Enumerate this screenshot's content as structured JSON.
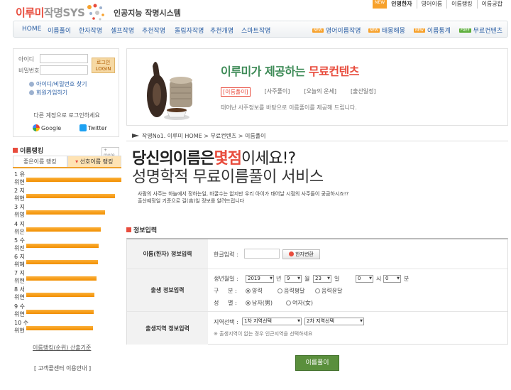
{
  "header": {
    "logo_red": "이루미",
    "logo_gray": "작명SYS",
    "subtitle": "인공지능 작명시스템",
    "top_links": [
      {
        "label": "인명한자",
        "badge": "NEW"
      },
      {
        "label": "영어이름"
      },
      {
        "label": "이름랭킹"
      },
      {
        "label": "이름궁합"
      }
    ]
  },
  "nav": [
    {
      "label": "HOME"
    },
    {
      "label": "이름풀이"
    },
    {
      "label": "한자작명"
    },
    {
      "label": "셀프작명"
    },
    {
      "label": "추천작명"
    },
    {
      "label": "돌림자작명"
    },
    {
      "label": "추천개명"
    },
    {
      "label": "스마트작명"
    },
    {
      "label": "영어이름작명",
      "badge": "NEW"
    },
    {
      "label": "태몽해몽",
      "badge": "NEW"
    },
    {
      "label": "이름통계",
      "badge": "NEW"
    },
    {
      "label": "무료컨텐츠",
      "badge": "FREE"
    }
  ],
  "login": {
    "id_label": "아이디",
    "pw_label": "비밀번호",
    "login_button_1": "로그인",
    "login_button_2": "LOGIN",
    "find_link": "아이디/비밀번호 찾기",
    "join_link": "회원가입하기",
    "social_note": "다른 계정으로 로그인하세요",
    "google": "Google",
    "twitter": "Twitter"
  },
  "ranking": {
    "title": "이름랭킹",
    "more": "more",
    "tabs": [
      "좋은이름 랭킹",
      "선호이름 랭킹"
    ],
    "rows": [
      {
        "line1": "1 유",
        "line2": "위현",
        "fill": 1.0
      },
      {
        "line1": "2 지",
        "line2": "위현",
        "fill": 0.93
      },
      {
        "line1": "3 지",
        "line2": "위영",
        "fill": 0.83
      },
      {
        "line1": "4 지",
        "line2": "위은",
        "fill": 0.78
      },
      {
        "line1": "5 수",
        "line2": "위진",
        "fill": 0.76
      },
      {
        "line1": "6 지",
        "line2": "위혜",
        "fill": 0.75
      },
      {
        "line1": "7 지",
        "line2": "위현",
        "fill": 0.74
      },
      {
        "line1": "8 서",
        "line2": "위연",
        "fill": 0.72
      },
      {
        "line1": "9 수",
        "line2": "위연",
        "fill": 0.71
      },
      {
        "line1": "10 수",
        "line2": "위현",
        "fill": 0.7
      }
    ],
    "footer_link": "이름랭킹(순위) 산출기준",
    "help_link": "[ 고객콜센터 이용안내 ]"
  },
  "promo": {
    "title_green": "이루미가 제공하는 ",
    "title_red": "무료컨텐츠",
    "tabs": [
      "[이름풀이]",
      "[사주풀이]",
      "[오늘의 운세]",
      "[출산일정]"
    ],
    "desc": "태어난 사주정보를 바탕으로 이름풀이를 제공해 드립니다."
  },
  "breadcrumb": "작명No1. 이루미 HOME > 무료컨텐츠 > 이름풀이",
  "headline": {
    "part1": "당신의이름은",
    "part2": "몇점",
    "part3": "이세요!?",
    "line2": "성명학적 무료이름풀이 서비스",
    "intro1": "사람의 사주는 하늘에서 정하는일, 바꿀수는 없지만 우리 아이가 태어날 시점의 사주들이 궁금하시죠!?",
    "intro2": "출산예정일 기준으로 길(吉)일 정보를 알려드립니다"
  },
  "form": {
    "section_title": "정보입력",
    "row1": {
      "head": "이름(한자) 정보입력",
      "label": "한글입력 :",
      "value": "",
      "button": "한자변환"
    },
    "row2": {
      "head": "출생 정보입력",
      "birth_label": "생년월일 :",
      "year": "2019",
      "year_unit": "년",
      "month": "9",
      "month_unit": "월",
      "day": "23",
      "day_unit": "일",
      "hour": "0",
      "hour_unit": "시",
      "minute": "0",
      "minute_unit": "분",
      "type_label": "구     분 :",
      "type_options": [
        "양력",
        "음력평달",
        "음력윤달"
      ],
      "type_selected": 0,
      "gender_label": "성     별 :",
      "gender_options": [
        "남자(男)",
        "여자(女)"
      ],
      "gender_selected": 0
    },
    "row3": {
      "head": "출생지역 정보입력",
      "label": "지역선택 :",
      "select1": "1차 지역선택",
      "select2": "2차 지역선택",
      "note": "※ 출생지역이 없는 경우 인근지역을 선택하세요"
    },
    "submit": "이름풀이"
  }
}
